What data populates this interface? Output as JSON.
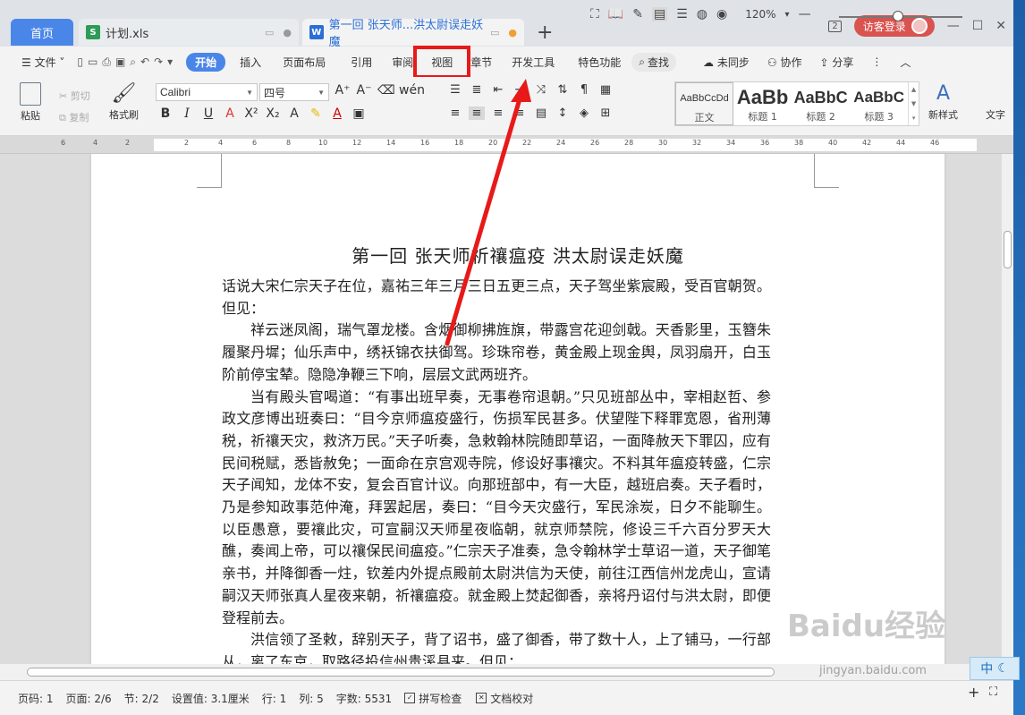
{
  "tabs": {
    "home": "首页",
    "xls": "计划.xls",
    "doc": "第一回 张天师...洪太尉误走妖魔",
    "add": "+"
  },
  "titlebar": {
    "badge": "2",
    "login": "访客登录"
  },
  "menu": {
    "file": "文件",
    "items": [
      "开始",
      "插入",
      "页面布局",
      "引用",
      "审阅",
      "视图",
      "章节",
      "开发工具",
      "特色功能"
    ],
    "search": "查找",
    "sync": "未同步",
    "collab": "协作",
    "share": "分享"
  },
  "ribbon": {
    "paste": "粘贴",
    "cut": "剪切",
    "copy": "复制",
    "format_painter": "格式刷",
    "font": "Calibri",
    "size": "四号",
    "new_style": "新样式",
    "text_tools": "文字",
    "styles": [
      {
        "preview": "AaBbCcDd",
        "name": "正文"
      },
      {
        "preview": "AaBb",
        "name": "标题 1"
      },
      {
        "preview": "AaBbC",
        "name": "标题 2"
      },
      {
        "preview": "AaBbC",
        "name": "标题 3"
      }
    ]
  },
  "ruler": {
    "left": [
      "6",
      "4",
      "2"
    ],
    "ticks": [
      "2",
      "4",
      "6",
      "8",
      "10",
      "12",
      "14",
      "16",
      "18",
      "20",
      "22",
      "24",
      "26",
      "28",
      "30",
      "32",
      "34",
      "36",
      "38",
      "40",
      "42",
      "44",
      "46"
    ]
  },
  "document": {
    "title": "第一回  张天师祈禳瘟疫    洪太尉误走妖魔",
    "paragraphs": [
      "话说大宋仁宗天子在位，嘉祐三年三月三日五更三点，天子驾坐紫宸殿，受百官朝贺。但见：",
      "祥云迷凤阁，瑞气罩龙楼。含烟御柳拂旌旗，带露宫花迎剑戟。天香影里，玉簪朱履聚丹墀；仙乐声中，绣袄锦衣扶御驾。珍珠帘卷，黄金殿上现金舆，凤羽扇开，白玉阶前停宝辇。隐隐净鞭三下响，层层文武两班齐。",
      "当有殿头官喝道：“有事出班早奏，无事卷帘退朝。”只见班部丛中，宰相赵哲、参政文彦博出班奏曰：“目今京师瘟疫盛行，伤损军民甚多。伏望陛下释罪宽恩，省刑薄税，祈禳天灾，救济万民。”天子听奏，急敕翰林院随即草诏，一面降赦天下罪囚，应有民间税赋，悉皆赦免；一面命在京宫观寺院，修设好事禳灾。不料其年瘟疫转盛，仁宗天子闻知，龙体不安，复会百官计议。向那班部中，有一大臣，越班启奏。天子看时，乃是参知政事范仲淹，拜罢起居，奏曰：“目今天灾盛行，军民涂炭，日夕不能聊生。以臣愚意，要禳此灾，可宣嗣汉天师星夜临朝，就京师禁院，修设三千六百分罗天大醮，奏闻上帝，可以禳保民间瘟疫。”仁宗天子准奏，急令翰林学士草诏一道，天子御笔亲书，并降御香一炷，钦差内外提点殿前太尉洪信为天使，前往江西信州龙虎山，宣请嗣汉天师张真人星夜来朝，祈禳瘟疫。就金殿上焚起御香，亲将丹诏付与洪太尉，即便登程前去。",
      "洪信领了圣敕，辞别天子，背了诏书，盛了御香，带了数十人，上了铺马，一行部从，离了东京，取路径投信州贵溪县来。但见："
    ]
  },
  "status": {
    "page_no": "页码: 1",
    "pages": "页面: 2/6",
    "section": "节: 2/2",
    "setting": "设置值: 3.1厘米",
    "line": "行: 1",
    "col": "列: 5",
    "words": "字数: 5531",
    "spell": "拼写检查",
    "proof": "文档校对",
    "zoom": "120%"
  },
  "overlay": {
    "watermark": "Baidu经验",
    "watermark_url": "jingyan.baidu.com",
    "ime": "中",
    "accent": "#e81919"
  }
}
